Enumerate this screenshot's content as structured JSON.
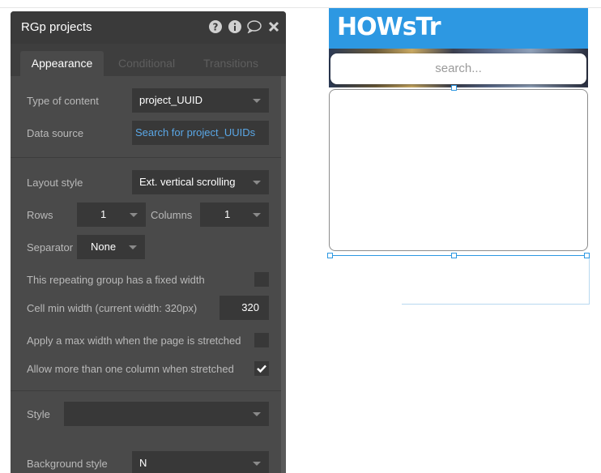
{
  "panel": {
    "title": "RGp projects",
    "icons": [
      "help-icon",
      "info-icon",
      "comment-icon",
      "close-icon"
    ],
    "tabs": [
      {
        "label": "Appearance",
        "active": true
      },
      {
        "label": "Conditional",
        "active": false
      },
      {
        "label": "Transitions",
        "active": false
      }
    ],
    "type_of_content": {
      "label": "Type of content",
      "value": "project_UUID"
    },
    "data_source": {
      "label": "Data source",
      "value": "Search for project_UUIDs"
    },
    "layout_style": {
      "label": "Layout style",
      "value": "Ext. vertical scrolling"
    },
    "rows": {
      "label": "Rows",
      "value": "1"
    },
    "columns": {
      "label": "Columns",
      "value": "1"
    },
    "separator": {
      "label": "Separator",
      "value": "None"
    },
    "fixed_width": {
      "label": "This repeating group has a fixed width",
      "checked": false
    },
    "cell_min_width": {
      "label": "Cell min width (current width: 320px)",
      "value": "320"
    },
    "max_width": {
      "label": "Apply a max width when the page is stretched",
      "checked": false
    },
    "multi_column": {
      "label": "Allow more than one column when stretched",
      "checked": true
    },
    "style": {
      "label": "Style",
      "value": ""
    },
    "background_style": {
      "label": "Background style",
      "value": "N"
    }
  },
  "canvas": {
    "logo_text": "HOWsTr",
    "search_placeholder": "search..."
  },
  "colors": {
    "panel_bg": "#4a4a4a",
    "header_bg": "#3a3a3a",
    "field_bg": "#383838",
    "link": "#5aa7e6",
    "brand_blue": "#2d98e2"
  }
}
